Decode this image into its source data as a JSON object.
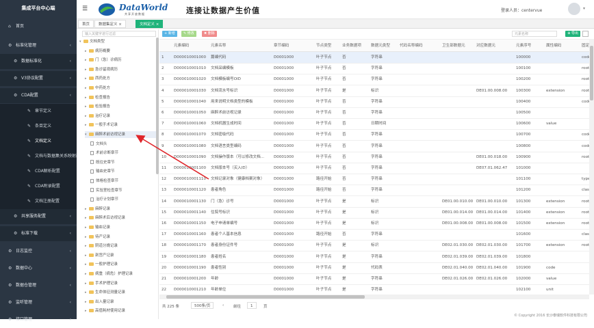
{
  "sidebar": {
    "title": "集成平台中心端",
    "items": [
      {
        "label": "首页",
        "icon": "home-icon",
        "glyph": "⌂"
      },
      {
        "label": "标准化管理",
        "icon": "gear-icon",
        "glyph": "⚙"
      },
      {
        "label": "数据标准化",
        "icon": "gear-icon",
        "glyph": "⚙"
      },
      {
        "label": "V3协议配置",
        "icon": "gear-icon",
        "glyph": "⚙"
      },
      {
        "label": "CDA配置",
        "icon": "gear-icon",
        "glyph": "⚙"
      },
      {
        "label": "章节定义",
        "icon": "wrench-icon",
        "glyph": "✎"
      },
      {
        "label": "条目定义",
        "icon": "wrench-icon",
        "glyph": "✎"
      },
      {
        "label": "文档定义",
        "icon": "wrench-icon",
        "glyph": "✎"
      },
      {
        "label": "文档与数据集关系映射配置",
        "icon": "wrench-icon",
        "glyph": "✎"
      },
      {
        "label": "CDA解析配置",
        "icon": "wrench-icon",
        "glyph": "✎"
      },
      {
        "label": "CDA附录配置",
        "icon": "wrench-icon",
        "glyph": "✎"
      },
      {
        "label": "文档注册配置",
        "icon": "wrench-icon",
        "glyph": "✎"
      },
      {
        "label": "共享服务配置",
        "icon": "gear-icon",
        "glyph": "⚙"
      },
      {
        "label": "标准下载",
        "icon": "gear-icon",
        "glyph": "⚙"
      },
      {
        "label": "日志监控",
        "icon": "gear-icon",
        "glyph": "⚙"
      },
      {
        "label": "数据中心",
        "icon": "gear-icon",
        "glyph": "⚙"
      },
      {
        "label": "数据仓管理",
        "icon": "gear-icon",
        "glyph": "⚙"
      },
      {
        "label": "监听管理",
        "icon": "gear-icon",
        "glyph": "⚙"
      },
      {
        "label": "接口管理",
        "icon": "gear-icon",
        "glyph": "⚙"
      }
    ]
  },
  "header": {
    "brand": "DataWorld",
    "brand_sub": "共享开放数据",
    "slogan": "连接让数据产生价值",
    "user": "登录人员：centervue"
  },
  "tabs": [
    {
      "label": "首页"
    },
    {
      "label": "数据集定义 ×"
    },
    {
      "label": "文档定义 ×"
    }
  ],
  "tree": {
    "search_placeholder": "输入关键字进行过滤",
    "nodes": [
      {
        "label": "文档类型",
        "type": "folder",
        "level": 0,
        "twisty": "▾"
      },
      {
        "label": "病历概要",
        "type": "folder",
        "level": 1,
        "twisty": "▸"
      },
      {
        "label": "门（急）诊病历",
        "type": "folder",
        "level": 1,
        "twisty": "▸"
      },
      {
        "label": "急诊留观病历",
        "type": "folder",
        "level": 1,
        "twisty": "▸"
      },
      {
        "label": "西药处方",
        "type": "folder",
        "level": 1,
        "twisty": "▸"
      },
      {
        "label": "中药处方",
        "type": "folder",
        "level": 1,
        "twisty": "▸"
      },
      {
        "label": "检查报告",
        "type": "folder",
        "level": 1,
        "twisty": "▸"
      },
      {
        "label": "检验报告",
        "type": "folder",
        "level": 1,
        "twisty": "▸"
      },
      {
        "label": "治疗记录",
        "type": "folder",
        "level": 1,
        "twisty": "▸"
      },
      {
        "label": "一般手术记录",
        "type": "folder",
        "level": 1,
        "twisty": "▸"
      },
      {
        "label": "麻醉术前访视记录",
        "type": "folder",
        "level": 1,
        "twisty": "▾",
        "selected": true
      },
      {
        "label": "文档头",
        "type": "file",
        "level": 2
      },
      {
        "label": "术前诊断章节",
        "type": "file",
        "level": 2
      },
      {
        "label": "既往史章节",
        "type": "file",
        "level": 2
      },
      {
        "label": "输血史章节",
        "type": "file",
        "level": 2
      },
      {
        "label": "体格检查章节",
        "type": "file",
        "level": 2
      },
      {
        "label": "实验室检查章节",
        "type": "file",
        "level": 2
      },
      {
        "label": "治疗计划章节",
        "type": "file",
        "level": 2
      },
      {
        "label": "麻醉记录",
        "type": "folder",
        "level": 1,
        "twisty": "▸"
      },
      {
        "label": "麻醉术后访视记录",
        "type": "folder",
        "level": 1,
        "twisty": "▸"
      },
      {
        "label": "输血记录",
        "type": "folder",
        "level": 1,
        "twisty": "▸"
      },
      {
        "label": "待产记录",
        "type": "folder",
        "level": 1,
        "twisty": "▸"
      },
      {
        "label": "阴道分娩记录",
        "type": "folder",
        "level": 1,
        "twisty": "▸"
      },
      {
        "label": "剖宫产记录",
        "type": "folder",
        "level": 1,
        "twisty": "▸"
      },
      {
        "label": "一般护理记录",
        "type": "folder",
        "level": 1,
        "twisty": "▸"
      },
      {
        "label": "病重（病危）护理记录",
        "type": "folder",
        "level": 1,
        "twisty": "▸"
      },
      {
        "label": "手术护理记录",
        "type": "folder",
        "level": 1,
        "twisty": "▸"
      },
      {
        "label": "生命体征测量记录",
        "type": "folder",
        "level": 1,
        "twisty": "▸"
      },
      {
        "label": "出入量记录",
        "type": "folder",
        "level": 1,
        "twisty": "▸"
      },
      {
        "label": "高值耗材使用记录",
        "type": "folder",
        "level": 1,
        "twisty": "▸"
      }
    ]
  },
  "toolbar": {
    "add": "+ 新增",
    "edit": "✎ 修改",
    "delete": "✖ 删除",
    "search_placeholder": "元素名称",
    "export": "⊕ 导出"
  },
  "table": {
    "columns": [
      "",
      "元素编码",
      "元素名称",
      "章节编码",
      "节点类型",
      "业务数据项",
      "数据元类型",
      "代码名称编码",
      "卫生部数据元",
      "对应数据元",
      "元素序号",
      "属性编码",
      "固定属性"
    ],
    "rows": [
      [
        "1",
        "D000010001000",
        "篇编代码",
        "D0001000",
        "叶子节点",
        "否",
        "字符串",
        "",
        "",
        "",
        "100000",
        "",
        "code"
      ],
      [
        "2",
        "D000010001010",
        "文档采编模板",
        "D0001000",
        "叶子节点",
        "否",
        "字符串",
        "",
        "",
        "",
        "100100",
        "",
        "root"
      ],
      [
        "3",
        "D000010001020",
        "文档模板编号OID",
        "D0001000",
        "叶子节点",
        "否",
        "字符串",
        "",
        "",
        "",
        "100200",
        "",
        "root"
      ],
      [
        "4",
        "D000010001030",
        "文档流水号标识",
        "D0001000",
        "叶子节点",
        "是",
        "标识",
        "",
        "",
        "DE01.00.008.00",
        "100300",
        "extension",
        "root"
      ],
      [
        "5",
        "D000010001040",
        "用来说明文档类型的模板",
        "D0001000",
        "叶子节点",
        "否",
        "字符串",
        "",
        "",
        "",
        "100400",
        "",
        "code"
      ],
      [
        "6",
        "D000010001050",
        "麻醉术前访视记录",
        "D0001000",
        "叶子节点",
        "否",
        "字符串",
        "",
        "",
        "",
        "100500",
        "",
        ""
      ],
      [
        "7",
        "D000010001060",
        "文档机器生成时间",
        "D0001000",
        "叶子节点",
        "否",
        "日期时间",
        "",
        "",
        "",
        "100600",
        "value",
        ""
      ],
      [
        "8",
        "D000010001070",
        "文档密级代码",
        "D0001000",
        "叶子节点",
        "否",
        "字符串",
        "",
        "",
        "",
        "100700",
        "",
        "code"
      ],
      [
        "9",
        "D000010001080",
        "文档语言类型编码",
        "D0001000",
        "叶子节点",
        "否",
        "字符串",
        "",
        "",
        "",
        "100800",
        "",
        "code"
      ],
      [
        "10",
        "D000010001090",
        "文档操作版本（可以修改文档...",
        "D0001000",
        "叶子节点",
        "否",
        "字符串",
        "",
        "",
        "DE01.00.018.00",
        "100900",
        "",
        "root"
      ],
      [
        "11",
        "D000010001100",
        "文档版本号（买入ID）",
        "D0001000",
        "叶子节点",
        "否",
        "字符串",
        "",
        "",
        "DE07.01.062.47",
        "101000",
        "",
        ""
      ],
      [
        "12",
        "D000010001110",
        "文档记录对象（健康档案对象）",
        "D0001000",
        "路径开始",
        "否",
        "字符串",
        "",
        "",
        "",
        "101100",
        "",
        "type"
      ],
      [
        "13",
        "D000010001120",
        "患者角色",
        "D0001000",
        "路径开始",
        "否",
        "字符串",
        "",
        "",
        "",
        "101200",
        "",
        "class"
      ],
      [
        "14",
        "D000010001130",
        "门（急）诊号",
        "D0001000",
        "叶子节点",
        "是",
        "标识",
        "",
        "DE01.00.010.00",
        "DE01.00.010.00",
        "101300",
        "extension",
        "root"
      ],
      [
        "15",
        "D000010001140",
        "住院号标识",
        "D0001000",
        "叶子节点",
        "是",
        "标识",
        "",
        "DE01.00.014.00",
        "DE01.00.014.00",
        "101400",
        "extension",
        "root"
      ],
      [
        "16",
        "D000010001150",
        "电子申请单编号",
        "D0001000",
        "叶子节点",
        "是",
        "标识",
        "",
        "DE01.00.008.00",
        "DE01.00.008.00",
        "101500",
        "extension",
        "root"
      ],
      [
        "17",
        "D000010001160",
        "患者个人基本信息",
        "D0001000",
        "路径开始",
        "否",
        "字符串",
        "",
        "",
        "",
        "101600",
        "",
        "class"
      ],
      [
        "18",
        "D000010001170",
        "患者身份证件号",
        "D0001000",
        "叶子节点",
        "是",
        "标识",
        "",
        "DE02.01.030.00",
        "DE02.01.030.00",
        "101700",
        "extension",
        "root"
      ],
      [
        "19",
        "D000010001180",
        "患者姓名",
        "D0001000",
        "叶子节点",
        "是",
        "字符串",
        "",
        "DE02.01.039.00",
        "DE02.01.039.00",
        "101800",
        "",
        ""
      ],
      [
        "20",
        "D000010001190",
        "患者性别",
        "D0001000",
        "叶子节点",
        "是",
        "代码表",
        "",
        "DE02.01.040.00",
        "DE02.01.040.00",
        "101900",
        "code",
        ""
      ],
      [
        "21",
        "D000010001200",
        "年龄",
        "D0001000",
        "叶子节点",
        "是",
        "字符串",
        "",
        "DE02.01.026.00",
        "DE02.01.026.00",
        "102000",
        "value",
        ""
      ],
      [
        "22",
        "D000010001210",
        "年龄单位",
        "D0001000",
        "叶子节点",
        "是",
        "字符串",
        "",
        "",
        "",
        "102100",
        "unit",
        ""
      ]
    ]
  },
  "pager": {
    "total": "共 225 条",
    "page_size": "500条/页",
    "prev": "‹",
    "goto_label": "前往",
    "page": "1",
    "page_suffix": "页"
  },
  "footer": "© Copyright 2016 长沙泰瑞软件科技有限公司",
  "colors": {
    "sidebar": "#2b3643",
    "accent": "#1fb37a",
    "arrow": "#e0262b"
  }
}
